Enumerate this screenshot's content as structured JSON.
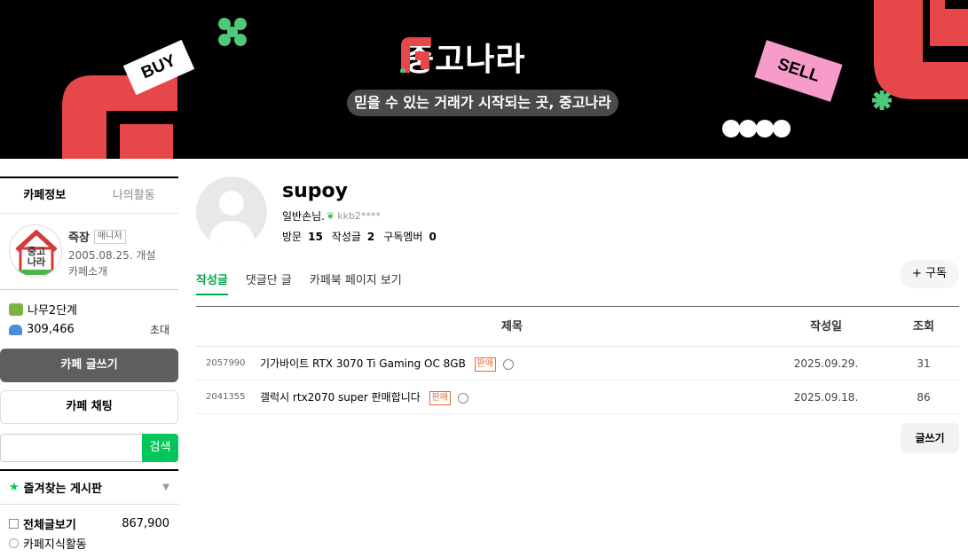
{
  "banner": {
    "brand": "중고나라",
    "slogan": "믿을 수 있는 거래가 시작되는 곳, 중고나라",
    "buy": "BUY",
    "sell": "SELL"
  },
  "sidebar": {
    "tabs": [
      "카페정보",
      "나의활동"
    ],
    "cafe": {
      "logo_text": [
        "중고",
        "나라"
      ],
      "name": "즉장",
      "role": "매니저",
      "founded": "2005.08.25. 개설",
      "intro": "카페소개"
    },
    "level": "나무2단계",
    "members": "309,466",
    "invite": "초대",
    "write_button": "카페 글쓰기",
    "chat_button": "카페 채팅",
    "search_button": "검색",
    "favorites": "즐겨찾는 게시판",
    "menu": [
      {
        "label": "전체글보기",
        "count": "867,900"
      },
      {
        "label": "카페지식활동",
        "count": ""
      }
    ]
  },
  "profile": {
    "nickname": "supoy",
    "grade": "일반손님.",
    "user_id": "kkb2****",
    "visits_label": "방문",
    "visits": "15",
    "posts_label": "작성글",
    "posts": "2",
    "subscribers_label": "구독멤버",
    "subscribers": "0",
    "subscribe_button": "+ 구독"
  },
  "tabs": [
    "작성글",
    "댓글단 글",
    "카페북 페이지 보기"
  ],
  "table": {
    "headers": {
      "title": "제목",
      "date": "작성일",
      "views": "조회"
    },
    "rows": [
      {
        "num": "2057990",
        "title": "기가바이트 RTX 3070 Ti Gaming OC 8GB",
        "tag": "판매",
        "date": "2025.09.29.",
        "views": "31"
      },
      {
        "num": "2041355",
        "title": "갤럭시 rtx2070 super 판매합니다",
        "tag": "판매",
        "date": "2025.09.18.",
        "views": "86"
      }
    ]
  },
  "write_post_button": "글쓰기",
  "colors": {
    "accent": "#03c75a",
    "brand_red": "#e8474a",
    "sale_tag": "#e46a30"
  }
}
